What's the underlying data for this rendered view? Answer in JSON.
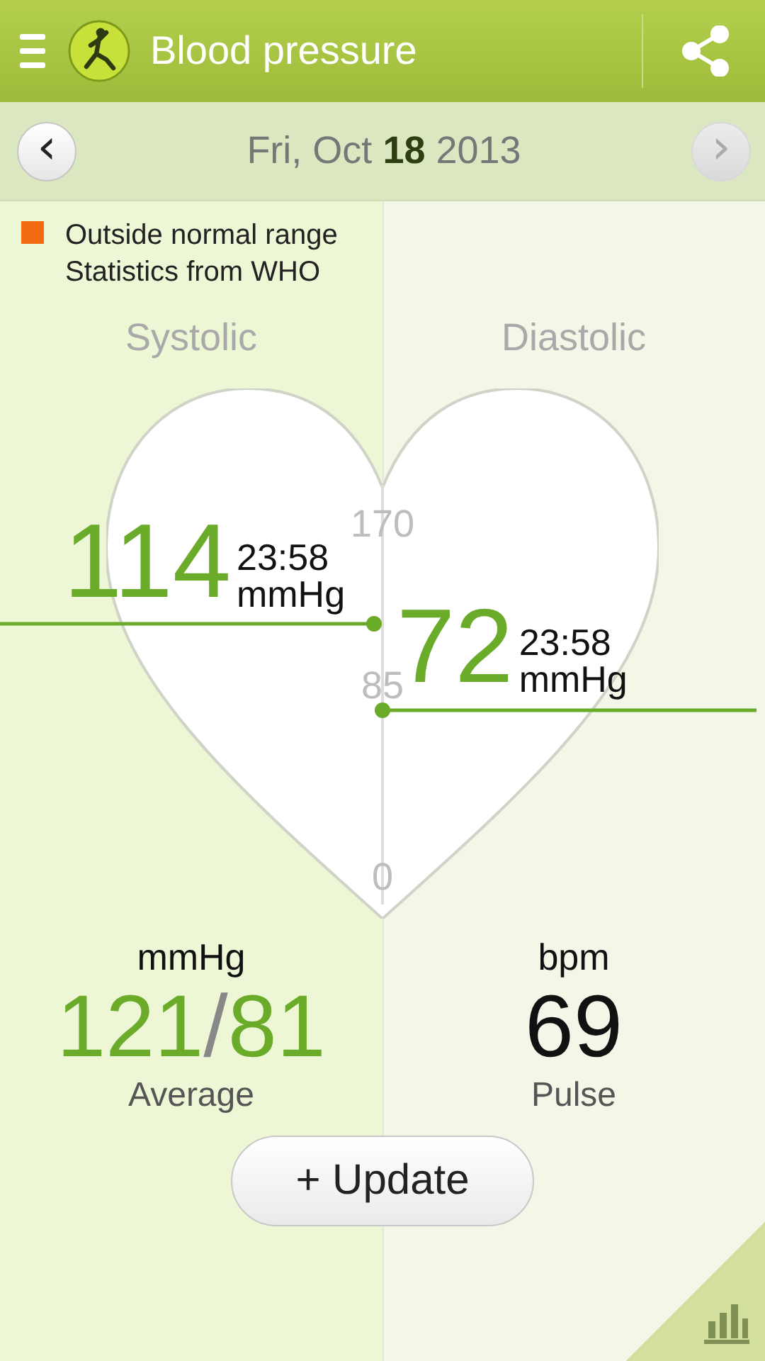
{
  "header": {
    "title": "Blood pressure"
  },
  "date_bar": {
    "date": "Fri, Oct **18** 2013",
    "prev": {
      "symbol": "‹",
      "disabled": false
    },
    "next": {
      "symbol": "›",
      "disabled": true
    }
  },
  "legend": [
    "Outside normal range",
    "Statistics from WHO"
  ],
  "columns": [
    "Systolic",
    "Diastolic"
  ],
  "scale_ticks": [
    "170",
    "85",
    "0"
  ],
  "readings": [
    {
      "kind": "systolic",
      "value": "114",
      "time": "23:58",
      "unit": "mmHg"
    },
    {
      "kind": "diastolic",
      "value": "72",
      "time": "23:58",
      "unit": "mmHg"
    }
  ],
  "average": {
    "unit": "mmHg",
    "systolic": "121",
    "separator": "/",
    "diastolic": "81",
    "label": "Average"
  },
  "pulse": {
    "unit": "bpm",
    "value": "69",
    "label": "Pulse"
  },
  "update_button": "+ Update"
}
